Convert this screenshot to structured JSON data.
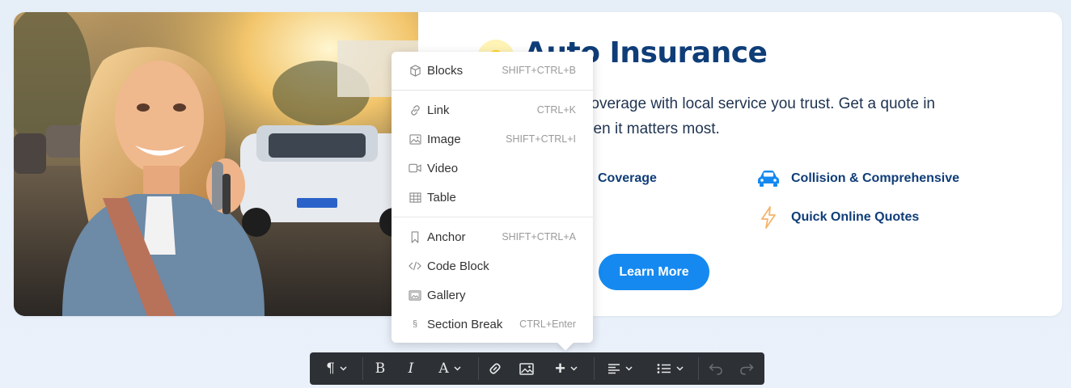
{
  "hero": {
    "title": "Auto Insurance",
    "description": "ble auto coverage with local service you trust. Get a quote in idance when it matters most.",
    "desc_line1": "ble auto coverage with local service you trust. Get a quote in",
    "desc_line2": "idance when it matters most.",
    "features": [
      {
        "label": "Coverage",
        "icon": "shield-icon"
      },
      {
        "label": "Collision & Comprehensive",
        "icon": "car-icon"
      },
      {
        "label": "Quick Online Quotes",
        "icon": "lightning-icon"
      }
    ],
    "cta_label": "Learn More"
  },
  "menu": {
    "items": [
      {
        "label": "Blocks",
        "shortcut": "SHIFT+CTRL+B",
        "icon": "cube-icon"
      },
      {
        "label": "Link",
        "shortcut": "CTRL+K",
        "icon": "link-icon"
      },
      {
        "label": "Image",
        "shortcut": "SHIFT+CTRL+I",
        "icon": "image-icon"
      },
      {
        "label": "Video",
        "shortcut": "",
        "icon": "video-icon"
      },
      {
        "label": "Table",
        "shortcut": "",
        "icon": "table-icon"
      },
      {
        "label": "Anchor",
        "shortcut": "SHIFT+CTRL+A",
        "icon": "bookmark-icon"
      },
      {
        "label": "Code Block",
        "shortcut": "",
        "icon": "code-icon"
      },
      {
        "label": "Gallery",
        "shortcut": "",
        "icon": "gallery-icon"
      },
      {
        "label": "Section Break",
        "shortcut": "CTRL+Enter",
        "icon": "section-icon"
      }
    ],
    "section_glyph": "§"
  },
  "toolbar": {
    "paragraph_glyph": "¶",
    "bold_glyph": "B",
    "italic_glyph": "I",
    "text_color_glyph": "A",
    "plus_glyph": "+"
  },
  "colors": {
    "accent": "#1589f0",
    "title": "#0f3d78",
    "toolbar_bg": "#2d3136"
  }
}
